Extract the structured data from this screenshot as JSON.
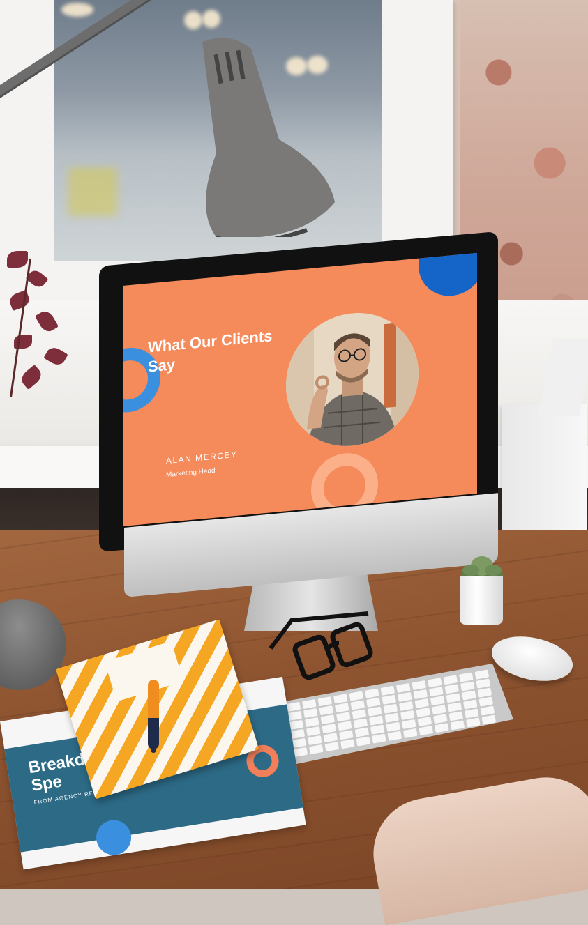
{
  "slide": {
    "title": "What Our Clients Say",
    "name": "ALAN MERCEY",
    "role": "Marketing Head"
  },
  "report": {
    "title": "Breakdown of Ad Spe",
    "subtitle": "FROM AGENCY REPO"
  },
  "colors": {
    "slide_background": "#f58a5b",
    "accent_blue": "#1565c9",
    "ring_blue": "#3a8fde",
    "desk_wood": "#8f5531"
  }
}
